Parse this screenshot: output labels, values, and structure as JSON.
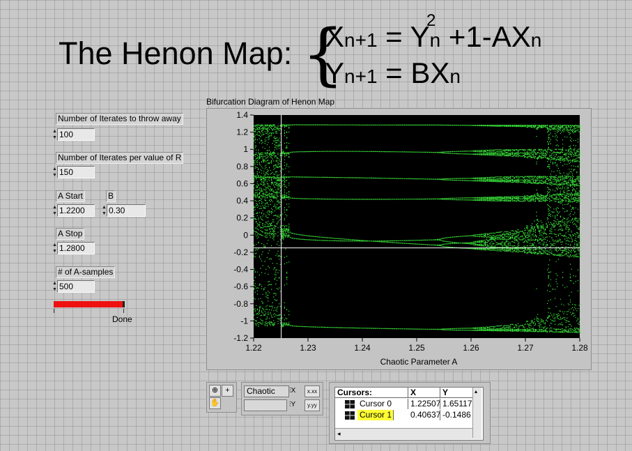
{
  "title": {
    "text": "The Henon Map:",
    "brace": "{",
    "eq1": {
      "x": "X",
      "n1": "n+1",
      "eq": " = ",
      "y": "Y",
      "exp": "2",
      "n": "n",
      "rest": " +1-AX",
      "n2": "n"
    },
    "eq2": {
      "y": "Y",
      "n1": "n+1",
      "eq": " = BX",
      "n": "n"
    }
  },
  "controls": {
    "throw_away": {
      "label": "Number of Iterates to throw away",
      "value": "100"
    },
    "per_value": {
      "label": "Number of Iterates per value of R",
      "value": "150"
    },
    "a_start": {
      "label": "A Start",
      "value": "1.2200"
    },
    "b": {
      "label": "B",
      "value": "0.30"
    },
    "a_stop": {
      "label": "A Stop",
      "value": "1.2800"
    },
    "a_samples": {
      "label": "# of A-samples",
      "value": "500"
    },
    "progress": {
      "label": "Done",
      "fraction": 1.0,
      "color": "#ef1010"
    }
  },
  "graph": {
    "title": "Bifurcation Diagram of Henon Map",
    "xlabel": "Chaotic Parameter A",
    "yticks": [
      "1.4",
      "1.2",
      "1",
      "0.8",
      "0.6",
      "0.4",
      "0.2",
      "0",
      "-0.2",
      "-0.4",
      "-0.6",
      "-0.8",
      "-1",
      "-1.2"
    ],
    "xticks": [
      "1.22",
      "1.23",
      "1.24",
      "1.25",
      "1.26",
      "1.27",
      "1.28"
    ],
    "bg_color": "#000000",
    "point_color": "#3cf03c",
    "cursor_color": "#ffffff"
  },
  "chart_data": {
    "type": "scatter",
    "title": "Bifurcation Diagram of Henon Map",
    "xlabel": "Chaotic Parameter A",
    "ylabel": "",
    "xlim": [
      1.22,
      1.28
    ],
    "ylim": [
      -1.2,
      1.4
    ],
    "series": [
      {
        "values_summary": "Henon attractor x-values for A from 1.22 to 1.28, B = 0.30: chaotic bands near A 1.22-1.225 and 1.27-1.28, a 7-cycle window around A 1.23-1.26 with branches near 1.28, 0.97, 0.66, 0.42, -0.05, -1.05, period doubling near A 1.255-1.265"
      }
    ],
    "cursors": [
      {
        "name": "Cursor 0",
        "x": 1.22507,
        "y": 1.65117
      },
      {
        "name": "Cursor 1",
        "x": 0.40637,
        "y": -0.1486
      }
    ]
  },
  "palette": {
    "plot_name": "Chaotic",
    "plot_name2": "",
    "zoom_icon": "zoom-icon",
    "cursor_icon": "crosshair-icon",
    "pan_icon": "hand-icon"
  },
  "cursors_table": {
    "headers": [
      "Cursors:",
      "X",
      "Y"
    ],
    "rows": [
      {
        "name": "Cursor 0",
        "x": "1.22507",
        "y": "1.65117",
        "highlight": false
      },
      {
        "name": "Cursor 1",
        "x": "0.40637",
        "y": "-0.1486",
        "highlight": true
      }
    ],
    "highlight_color": "#ffff33"
  }
}
